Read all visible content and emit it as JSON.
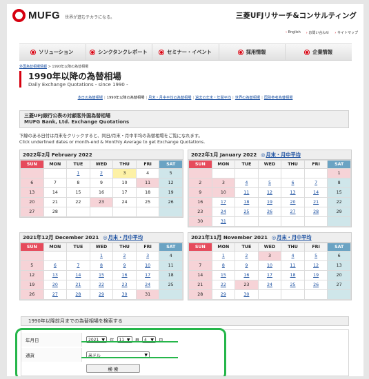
{
  "header": {
    "brand": "MUFG",
    "tagline": "世界が進むチカラになる。",
    "company": "三菱UFJリサーチ&コンサルティング",
    "utility_links": [
      "English",
      "お問い合わせ",
      "サイトマップ"
    ]
  },
  "nav": {
    "items": [
      "ソリューション",
      "シンクタンクレポート",
      "セミナー・イベント",
      "採用情報",
      "企業情報"
    ]
  },
  "breadcrumb": {
    "home": "外国為替相場情報",
    "sep": ">",
    "current": "1990年以降の為替相場"
  },
  "page": {
    "title": "1990年以降の為替相場",
    "subtitle": "Daily Exchange Quotations - since 1990 -"
  },
  "subnav": {
    "items": [
      "本日の為替相場",
      "1990年以降の為替相場",
      "月末・月中平均の為替相場",
      "過去の年末・年間平均",
      "世界の為替相場",
      "国別参考為替相場"
    ]
  },
  "bank": {
    "line1": "三菱UFJ銀行公表の対顧客外国為替相場",
    "line2": "MUFG Bank, Ltd. Exchange Quotations"
  },
  "notes": {
    "jp": "下線のある日付は月末をクリックすると、同日/月末・月中平均の為替相場をご覧になれます。",
    "en": "Click underlined dates or month-end & Monthly Average to get Exchange Quotations."
  },
  "weekdays": [
    "SUN",
    "MON",
    "TUE",
    "WED",
    "THU",
    "FRI",
    "SAT"
  ],
  "calendars": [
    {
      "title": "2022年2月 February 2022",
      "avg_link": "",
      "weeks": [
        [
          "",
          "",
          "1",
          "2",
          "3",
          "4",
          "5"
        ],
        [
          "6",
          "7",
          "8",
          "9",
          "10",
          "11",
          "12"
        ],
        [
          "13",
          "14",
          "15",
          "16",
          "17",
          "18",
          "19"
        ],
        [
          "20",
          "21",
          "22",
          "23",
          "24",
          "25",
          "26"
        ],
        [
          "27",
          "28",
          "",
          "",
          "",
          "",
          ""
        ]
      ],
      "links": [
        "1",
        "2"
      ],
      "holidays": [
        "11",
        "23"
      ],
      "today": "3"
    },
    {
      "title": "2022年1月 January 2022",
      "avg_link": "月末・月中平均",
      "weeks": [
        [
          "",
          "",
          "",
          "",
          "",
          "",
          "1"
        ],
        [
          "2",
          "3",
          "4",
          "5",
          "6",
          "7",
          "8"
        ],
        [
          "9",
          "10",
          "11",
          "12",
          "13",
          "14",
          "15"
        ],
        [
          "16",
          "17",
          "18",
          "19",
          "20",
          "21",
          "22"
        ],
        [
          "23",
          "24",
          "25",
          "26",
          "27",
          "28",
          "29"
        ],
        [
          "30",
          "31",
          "",
          "",
          "",
          "",
          ""
        ]
      ],
      "links": [
        "4",
        "5",
        "6",
        "7",
        "11",
        "12",
        "13",
        "14",
        "17",
        "18",
        "19",
        "20",
        "21",
        "24",
        "25",
        "26",
        "27",
        "28",
        "31"
      ],
      "holidays": [
        "1",
        "3",
        "10"
      ],
      "today": ""
    },
    {
      "title": "2021年12月 December 2021",
      "avg_link": "月末・月中平均",
      "weeks": [
        [
          "",
          "",
          "",
          "1",
          "2",
          "3",
          "4"
        ],
        [
          "5",
          "6",
          "7",
          "8",
          "9",
          "10",
          "11"
        ],
        [
          "12",
          "13",
          "14",
          "15",
          "16",
          "17",
          "18"
        ],
        [
          "19",
          "20",
          "21",
          "22",
          "23",
          "24",
          "25"
        ],
        [
          "26",
          "27",
          "28",
          "29",
          "30",
          "31",
          ""
        ]
      ],
      "links": [
        "1",
        "2",
        "3",
        "6",
        "7",
        "8",
        "9",
        "10",
        "13",
        "14",
        "15",
        "16",
        "17",
        "20",
        "21",
        "22",
        "23",
        "24",
        "27",
        "28",
        "29",
        "30"
      ],
      "holidays": [
        "31"
      ],
      "today": ""
    },
    {
      "title": "2021年11月 November 2021",
      "avg_link": "月末・月中平均",
      "weeks": [
        [
          "",
          "1",
          "2",
          "3",
          "4",
          "5",
          "6"
        ],
        [
          "7",
          "8",
          "9",
          "10",
          "11",
          "12",
          "13"
        ],
        [
          "14",
          "15",
          "16",
          "17",
          "18",
          "19",
          "20"
        ],
        [
          "21",
          "22",
          "23",
          "24",
          "25",
          "26",
          "27"
        ],
        [
          "28",
          "29",
          "30",
          "",
          "",
          "",
          ""
        ]
      ],
      "links": [
        "1",
        "2",
        "4",
        "5",
        "8",
        "9",
        "10",
        "11",
        "12",
        "15",
        "16",
        "17",
        "18",
        "19",
        "22",
        "24",
        "25",
        "26",
        "29",
        "30"
      ],
      "holidays": [
        "3",
        "23"
      ],
      "today": ""
    }
  ],
  "search": {
    "title": "1990年以降前月までの為替相場を検索する",
    "date_label": "年月日",
    "year": "2021",
    "year_unit": "年",
    "month": "11",
    "month_unit": "月",
    "day": "4",
    "day_unit": "日",
    "currency_label": "通貨",
    "currency": "米ドル",
    "button": "検 索"
  },
  "colors": {
    "brand_red": "#d6000f",
    "highlight": "#25b64a",
    "link": "#1a4fa0"
  }
}
